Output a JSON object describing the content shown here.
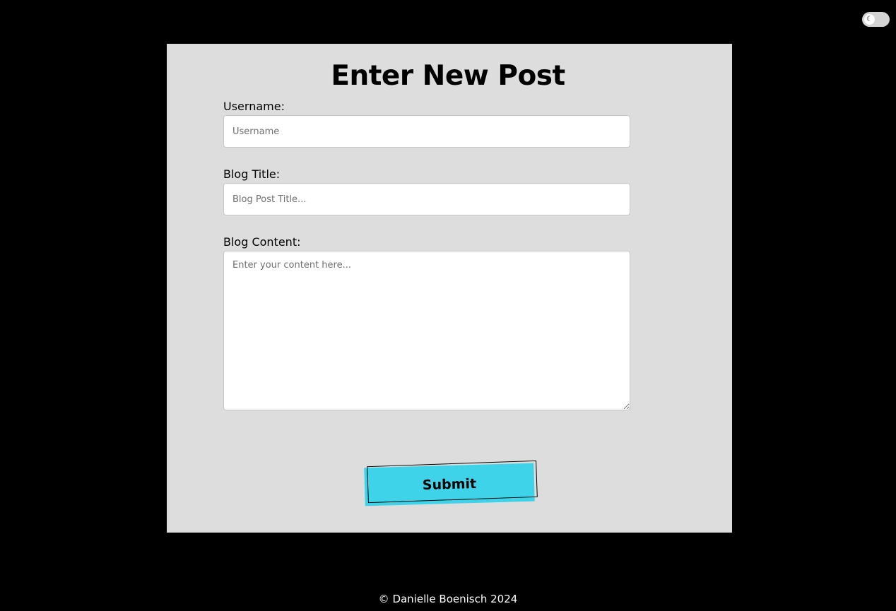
{
  "theme_toggle": {
    "icon": "moon-icon",
    "glyph": "☾"
  },
  "form": {
    "title": "Enter New Post",
    "username": {
      "label": "Username:",
      "placeholder": "Username",
      "value": ""
    },
    "blog_title": {
      "label": "Blog Title:",
      "placeholder": "Blog Post Title...",
      "value": ""
    },
    "blog_content": {
      "label": "Blog Content:",
      "placeholder": "Enter your content here...",
      "value": ""
    },
    "submit_label": "Submit"
  },
  "footer": {
    "text": "© Danielle Boenisch 2024"
  },
  "colors": {
    "page_background": "#000000",
    "card_background": "#dddddd",
    "button_accent": "#3ed3e8"
  }
}
